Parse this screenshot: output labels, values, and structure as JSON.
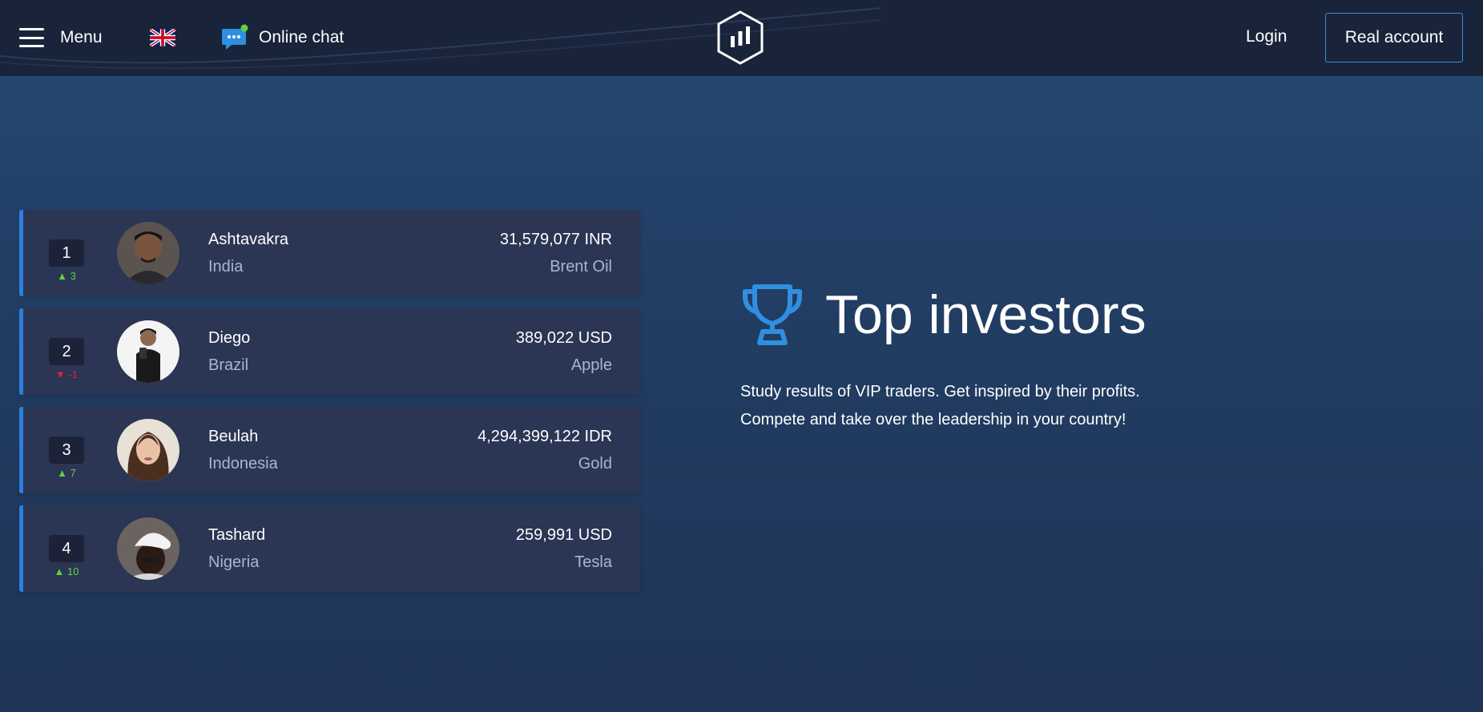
{
  "header": {
    "menu_label": "Menu",
    "chat_label": "Online chat",
    "login_label": "Login",
    "real_account_label": "Real account",
    "icons": {
      "menu": "hamburger-icon",
      "language": "uk-flag-icon",
      "chat": "chat-bubble-icon",
      "logo": "hexagon-bars-logo"
    },
    "colors": {
      "accent": "#2f8fe0",
      "chat_dot": "#5fd43a"
    }
  },
  "leaderboard": {
    "rows": [
      {
        "rank": "1",
        "change": "3",
        "direction": "up",
        "name": "Ashtavakra",
        "country": "India",
        "amount": "31,579,077 INR",
        "asset": "Brent Oil"
      },
      {
        "rank": "2",
        "change": "-1",
        "direction": "down",
        "name": "Diego",
        "country": "Brazil",
        "amount": "389,022 USD",
        "asset": "Apple"
      },
      {
        "rank": "3",
        "change": "7",
        "direction": "up",
        "name": "Beulah",
        "country": "Indonesia",
        "amount": "4,294,399,122 IDR",
        "asset": "Gold"
      },
      {
        "rank": "4",
        "change": "10",
        "direction": "up",
        "name": "Tashard",
        "country": "Nigeria",
        "amount": "259,991 USD",
        "asset": "Tesla"
      }
    ],
    "colors": {
      "up": "#5fd43a",
      "down": "#e0213a",
      "row_accent": "#2b7fe0"
    }
  },
  "hero": {
    "title": "Top investors",
    "line1": "Study results of VIP traders. Get inspired by their profits.",
    "line2": "Compete and take over the leadership in your country!",
    "icon": "trophy-icon",
    "icon_color": "#2f8fe0"
  }
}
